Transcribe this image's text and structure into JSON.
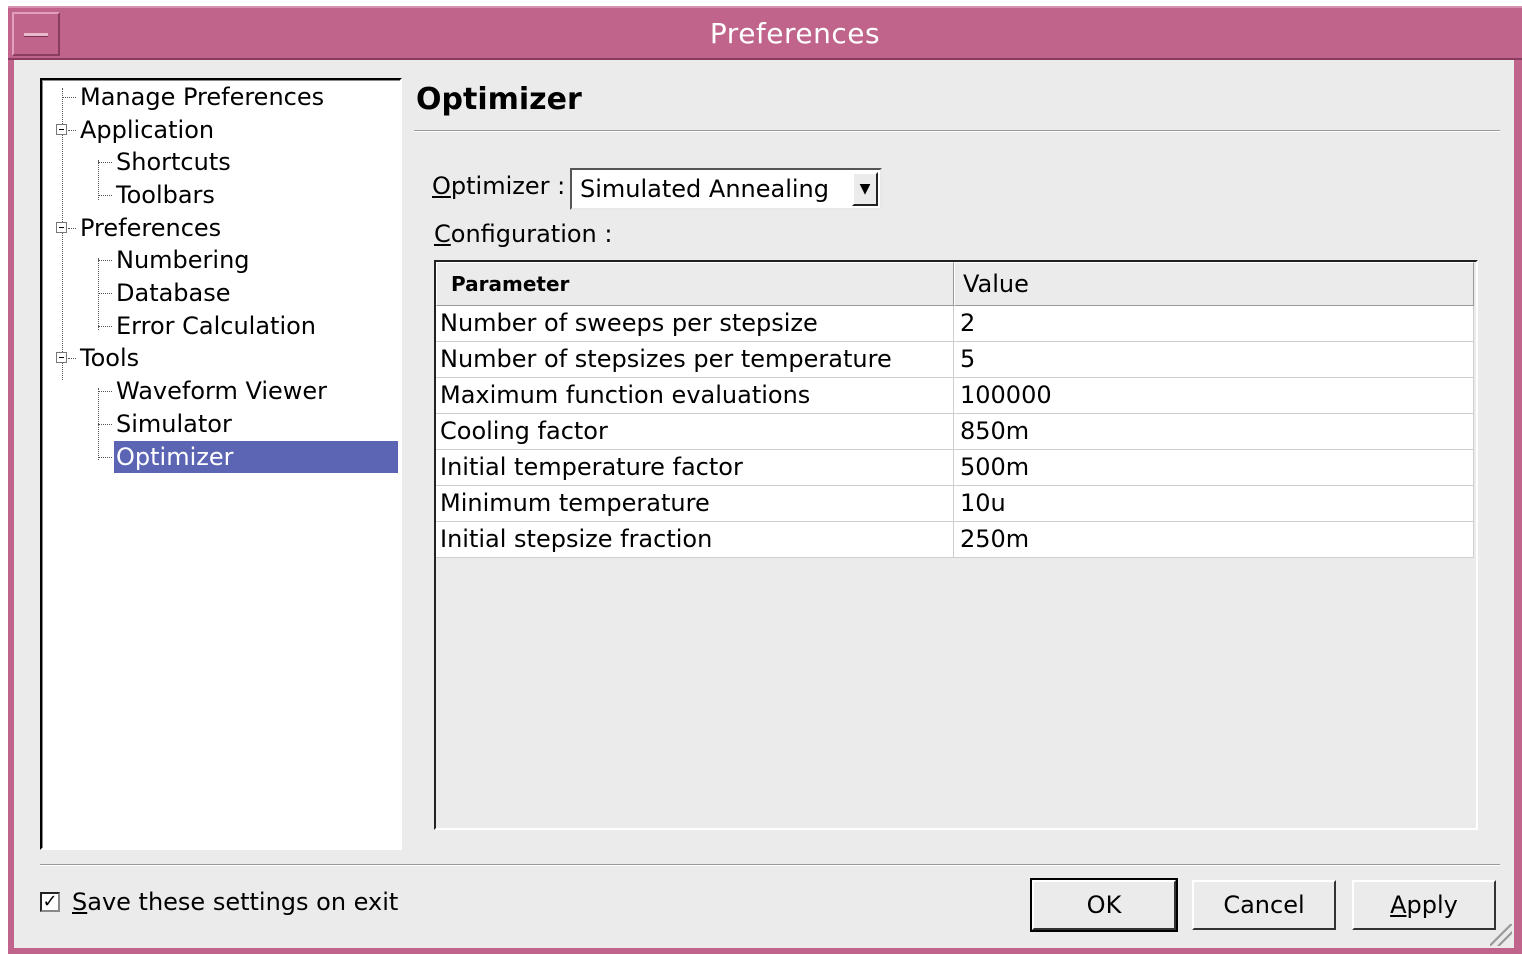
{
  "window": {
    "title": "Preferences"
  },
  "tree": {
    "items": [
      {
        "label": "Manage Preferences",
        "level": 0
      },
      {
        "label": "Application",
        "level": 0,
        "expanded": true
      },
      {
        "label": "Shortcuts",
        "level": 1
      },
      {
        "label": "Toolbars",
        "level": 1
      },
      {
        "label": "Preferences",
        "level": 0,
        "expanded": true
      },
      {
        "label": "Numbering",
        "level": 1
      },
      {
        "label": "Database",
        "level": 1
      },
      {
        "label": "Error Calculation",
        "level": 1
      },
      {
        "label": "Tools",
        "level": 0,
        "expanded": true
      },
      {
        "label": "Waveform Viewer",
        "level": 1
      },
      {
        "label": "Simulator",
        "level": 1
      },
      {
        "label": "Optimizer",
        "level": 1,
        "selected": true
      }
    ]
  },
  "page": {
    "title": "Optimizer",
    "optimizer_label_accel": "O",
    "optimizer_label_rest": "ptimizer :",
    "optimizer_value": "Simulated Annealing",
    "config_label_accel": "C",
    "config_label_rest": "onfiguration :"
  },
  "table": {
    "headers": {
      "parameter": "Parameter",
      "value": "Value"
    },
    "rows": [
      {
        "parameter": "Number of sweeps per stepsize",
        "value": "2"
      },
      {
        "parameter": "Number of stepsizes per temperature",
        "value": "5"
      },
      {
        "parameter": "Maximum function evaluations",
        "value": "100000"
      },
      {
        "parameter": "Cooling factor",
        "value": "850m"
      },
      {
        "parameter": "Initial temperature factor",
        "value": "500m"
      },
      {
        "parameter": "Minimum temperature",
        "value": "10u"
      },
      {
        "parameter": "Initial stepsize fraction",
        "value": "250m"
      }
    ]
  },
  "footer": {
    "save_checked": true,
    "save_label_accel": "S",
    "save_label_rest": "ave these settings on exit",
    "ok_label": "OK",
    "cancel_label": "Cancel",
    "apply_accel": "A",
    "apply_rest": "pply"
  },
  "colors": {
    "titlebar": "#c0648c",
    "selection": "#5b65b3",
    "background": "#ebebeb"
  }
}
